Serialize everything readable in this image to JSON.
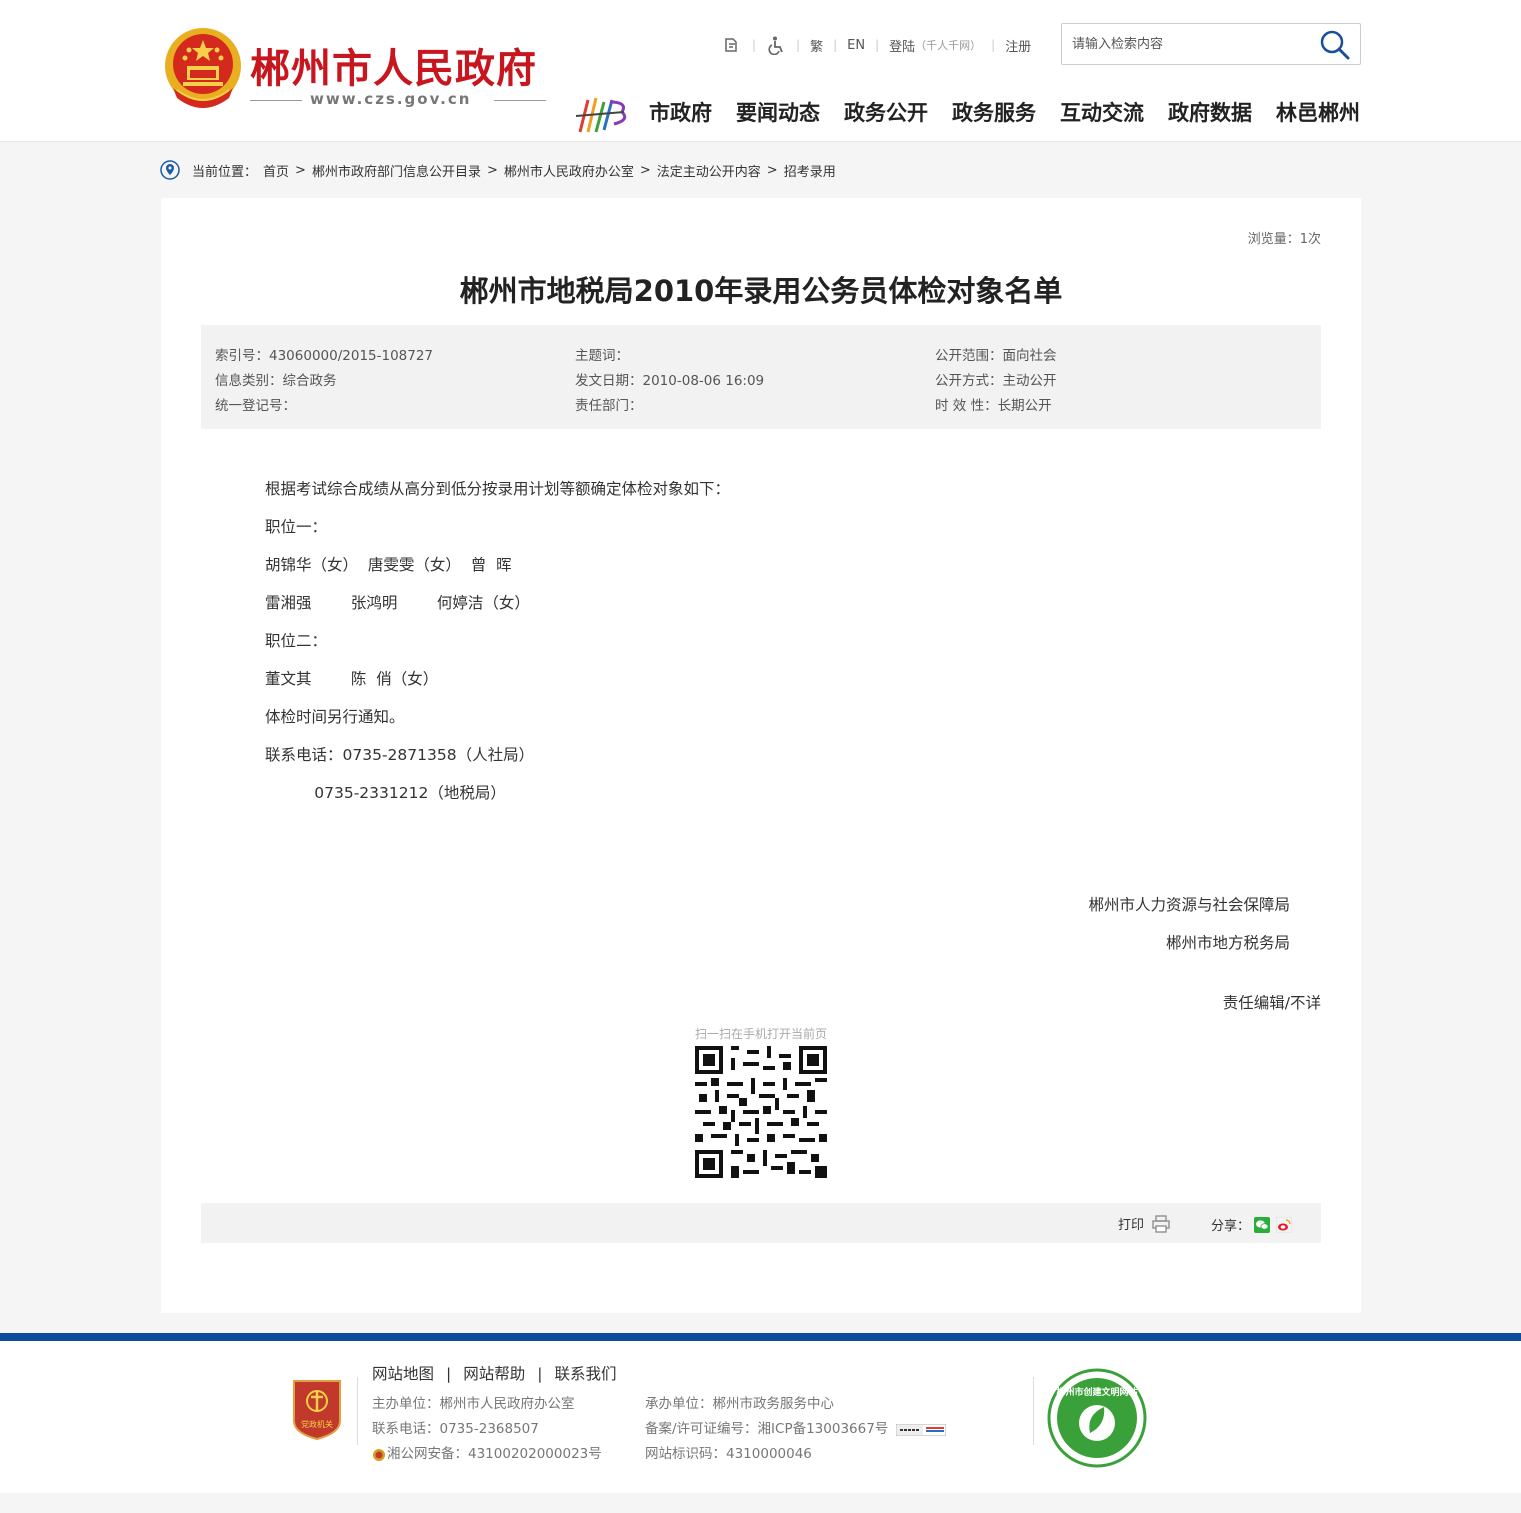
{
  "header": {
    "site_title": "郴州市人民政府",
    "site_url": "www.czs.gov.cn",
    "toplinks": {
      "traditional": "繁",
      "english": "EN",
      "login": "登陆",
      "login_note": "（千人千网）",
      "register": "注册"
    },
    "search": {
      "placeholder": "请输入检索内容"
    },
    "nav": [
      "市政府",
      "要闻动态",
      "政务公开",
      "政务服务",
      "互动交流",
      "政府数据",
      "林邑郴州"
    ]
  },
  "breadcrumb": {
    "label": "当前位置：",
    "items": [
      "首页",
      "郴州市政府部门信息公开目录",
      "郴州市人民政府办公室",
      "法定主动公开内容",
      "招考录用"
    ]
  },
  "article": {
    "views": "浏览量：1次",
    "title": "郴州市地税局2010年录用公务员体检对象名单",
    "meta": {
      "index_no": "索引号：43060000/2015-108727",
      "subject": "主题词：",
      "scope": "公开范围：面向社会",
      "category": "信息类别：综合政务",
      "date": "发文日期：2010-08-06 16:09",
      "method": "公开方式：主动公开",
      "reg_no": "统一登记号：",
      "dept": "责任部门：",
      "validity": "时 效 性：长期公开"
    },
    "paragraphs": [
      "根据考试综合成绩从高分到低分按录用计划等额确定体检对象如下：",
      "职位一：",
      "胡锦华（女）  唐雯雯（女）  曾  晖",
      "雷湘强        张鸿明        何婷洁（女）",
      "职位二：",
      "董文其        陈  俏（女）",
      "体检时间另行通知。",
      "联系电话：0735-2871358（人社局）",
      "          0735-2331212（地税局）"
    ],
    "signatures": [
      "郴州市人力资源与社会保障局",
      "郴州市地方税务局"
    ],
    "editor": "责任编辑/不详",
    "qr_caption": "扫一扫在手机打开当前页",
    "print_label": "打印",
    "share_label": "分享："
  },
  "footer": {
    "links": [
      "网站地图",
      "网站帮助",
      "联系我们"
    ],
    "col1": [
      "主办单位：郴州市人民政府办公室",
      "联系电话：0735-2368507",
      "湘公网安备：43100202000023号"
    ],
    "col2": [
      "承办单位：郴州市政务服务中心",
      "备案/许可证编号：湘ICP备13003667号",
      "网站标识码：4310000046"
    ],
    "badge_text": "党政机关",
    "emblem_text": "郴州市创建文明网站"
  },
  "colors": {
    "brand_red": "#c8161e",
    "footer_blue": "#0e4a9e"
  }
}
